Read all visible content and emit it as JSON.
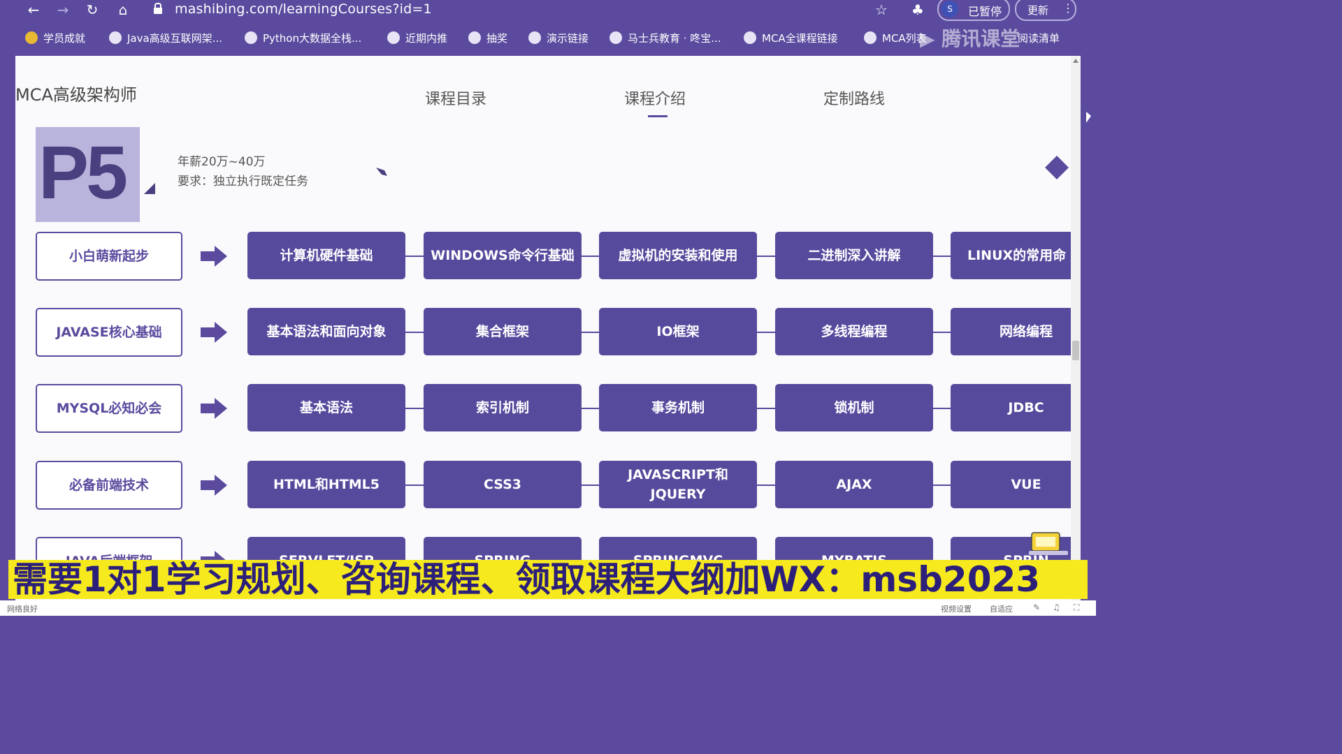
{
  "browser": {
    "url": "mashibing.com/learningCourses?id=1",
    "profile_initial": "S",
    "profile_status": "已暂停",
    "update_label": "更新",
    "bookmarks": [
      "学员成就",
      "Java高级互联网架...",
      "Python大数据全栈...",
      "近期内推",
      "抽奖",
      "演示链接",
      "马士兵教育 · 咚宝...",
      "MCA全课程链接",
      "MCA列表",
      "阅读清单"
    ],
    "watermark": "腾讯课堂"
  },
  "page": {
    "brand": "MCA高级架构师",
    "tabs": [
      {
        "label": "课程目录",
        "active": false
      },
      {
        "label": "课程介绍",
        "active": true
      },
      {
        "label": "定制路线",
        "active": false
      }
    ],
    "level": {
      "label": "P5",
      "salary": "年薪20万~40万",
      "requirement": "要求：独立执行既定任务"
    },
    "rows": [
      {
        "category": "小白萌新起步",
        "items": [
          "计算机硬件基础",
          "WINDOWS命令行基础",
          "虚拟机的安装和使用",
          "二进制深入讲解",
          "LINUX的常用命"
        ]
      },
      {
        "category": "JAVASE核心基础",
        "items": [
          "基本语法和面向对象",
          "集合框架",
          "IO框架",
          "多线程编程",
          "网络编程"
        ]
      },
      {
        "category": "MYSQL必知必会",
        "items": [
          "基本语法",
          "索引机制",
          "事务机制",
          "锁机制",
          "JDBC"
        ]
      },
      {
        "category": "必备前端技术",
        "items": [
          "HTML和HTML5",
          "CSS3",
          "JAVASCRIPT和JQUERY",
          "AJAX",
          "VUE"
        ]
      },
      {
        "category": "JAVA后端框架",
        "items": [
          "SERVLET/JSP",
          "SPRING",
          "SPRINGMVC",
          "MYBATIS",
          "SPRIN"
        ]
      }
    ]
  },
  "banner": "需要1对1学习规划、咨询课程、领取课程大纲加WX：msb2023",
  "statusbar": {
    "left": "网络良好",
    "video_settings": "视频设置",
    "adaptive": "自适应"
  },
  "colors": {
    "brand_purple": "#5b4a9e",
    "banner_yellow": "#f6ea1e",
    "banner_text": "#2c1f7a"
  }
}
